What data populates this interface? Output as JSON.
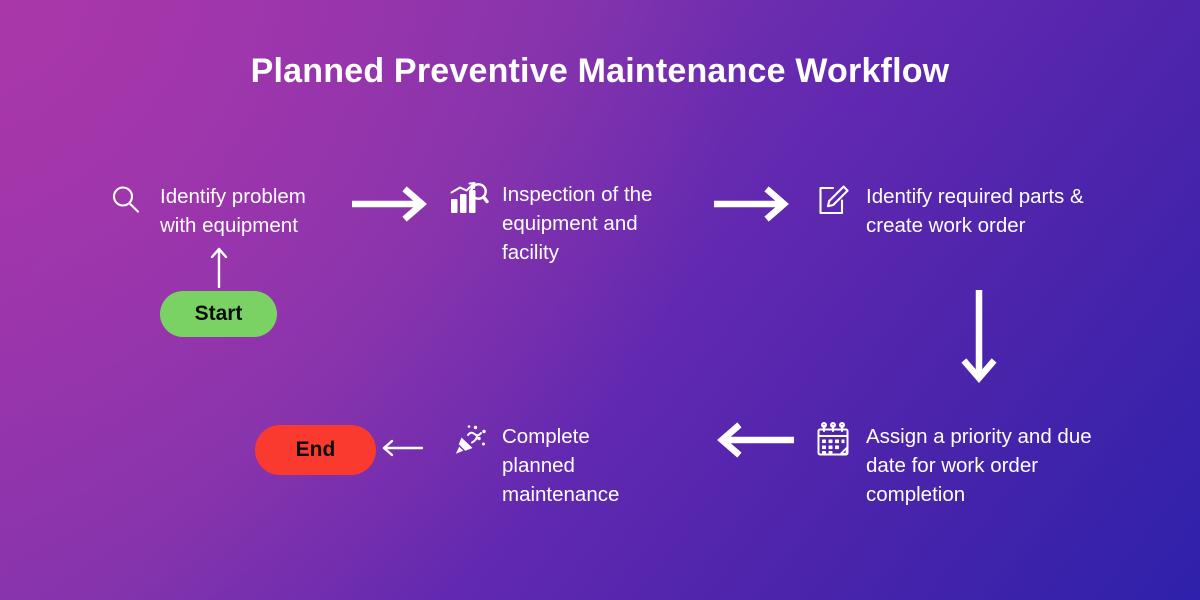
{
  "header": {
    "title": "Planned Preventive Maintenance Workflow"
  },
  "colors": {
    "background_start": "#9c36a8",
    "background_end": "#2e21ab",
    "text": "#ffffff",
    "start_pill": "#7ad264",
    "end_pill": "#fb3a2f",
    "terminator_text": "#0d0d0d",
    "arrow": "#ffffff"
  },
  "terminators": {
    "start": {
      "label": "Start",
      "shape": "pill",
      "color": "#7ad264"
    },
    "end": {
      "label": "End",
      "shape": "pill",
      "color": "#fb3a2f"
    }
  },
  "steps": [
    {
      "id": "step-1",
      "order": 1,
      "label": "Identify problem\nwith equipment",
      "icon": "magnifying-glass-icon"
    },
    {
      "id": "step-2",
      "order": 2,
      "label": "Inspection of the\nequipment and\nfacility",
      "icon": "bar-chart-analysis-icon"
    },
    {
      "id": "step-3",
      "order": 3,
      "label": "Identify required parts &\ncreate work order",
      "icon": "edit-document-icon"
    },
    {
      "id": "step-4",
      "order": 4,
      "label": "Assign a priority and due\ndate for work order\ncompletion",
      "icon": "calendar-icon"
    },
    {
      "id": "step-5",
      "order": 5,
      "label": "Complete\nplanned\nmaintenance",
      "icon": "party-popper-icon"
    }
  ],
  "connectors": [
    {
      "id": "connector-start-to-step1",
      "direction": "up",
      "from": "Start",
      "to": "Identify problem with equipment",
      "style": "thin"
    },
    {
      "id": "connector-step1-to-step2",
      "direction": "right",
      "from": "Identify problem with equipment",
      "to": "Inspection of the equipment and facility",
      "style": "thick"
    },
    {
      "id": "connector-step2-to-step3",
      "direction": "right",
      "from": "Inspection of the equipment and facility",
      "to": "Identify required parts & create work order",
      "style": "thick"
    },
    {
      "id": "connector-step3-to-step4",
      "direction": "down",
      "from": "Identify required parts & create work order",
      "to": "Assign a priority and due date for work order completion",
      "style": "thick"
    },
    {
      "id": "connector-step4-to-step5",
      "direction": "left",
      "from": "Assign a priority and due date for work order completion",
      "to": "Complete planned maintenance",
      "style": "thick"
    },
    {
      "id": "connector-step5-to-end",
      "direction": "left",
      "from": "Complete planned maintenance",
      "to": "End",
      "style": "thin"
    }
  ],
  "chart_data": {
    "type": "diagram",
    "diagram_type": "flowchart",
    "title": "Planned Preventive Maintenance Workflow",
    "nodes": [
      {
        "name": "Start",
        "type": "terminator"
      },
      {
        "name": "Identify problem with equipment",
        "type": "process"
      },
      {
        "name": "Inspection of the equipment and facility",
        "type": "process"
      },
      {
        "name": "Identify required parts & create work order",
        "type": "process"
      },
      {
        "name": "Assign a priority and due date for work order completion",
        "type": "process"
      },
      {
        "name": "Complete planned maintenance",
        "type": "process"
      },
      {
        "name": "End",
        "type": "terminator"
      }
    ],
    "edges": [
      [
        "Start",
        "Identify problem with equipment"
      ],
      [
        "Identify problem with equipment",
        "Inspection of the equipment and facility"
      ],
      [
        "Inspection of the equipment and facility",
        "Identify required parts & create work order"
      ],
      [
        "Identify required parts & create work order",
        "Assign a priority and due date for work order completion"
      ],
      [
        "Assign a priority and due date for work order completion",
        "Complete planned maintenance"
      ],
      [
        "Complete planned maintenance",
        "End"
      ]
    ]
  }
}
